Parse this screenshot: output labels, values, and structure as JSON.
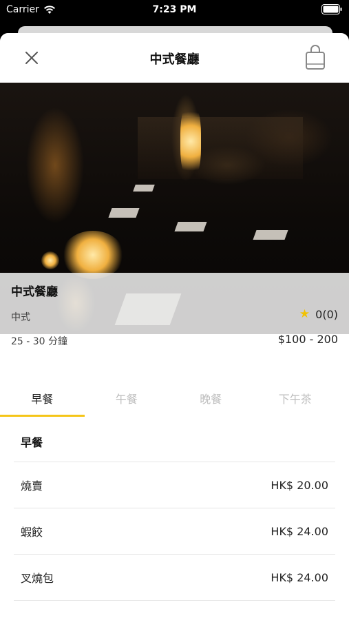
{
  "status_bar": {
    "carrier": "Carrier",
    "time": "7:23 PM"
  },
  "nav": {
    "title": "中式餐廳",
    "close_icon": "close-icon",
    "cart_icon": "shopping-bag-icon"
  },
  "restaurant": {
    "name": "中式餐廳",
    "cuisine": "中式",
    "rating": "0(0)",
    "delivery_time": "25 - 30 分鐘",
    "price_range": "$100 - 200"
  },
  "tabs": [
    {
      "label": "早餐",
      "active": true
    },
    {
      "label": "午餐",
      "active": false
    },
    {
      "label": "晚餐",
      "active": false
    },
    {
      "label": "下午茶",
      "active": false
    }
  ],
  "menu": {
    "section_title": "早餐",
    "items": [
      {
        "name": "燒賣",
        "price": "HK$ 20.00"
      },
      {
        "name": "蝦餃",
        "price": "HK$ 24.00"
      },
      {
        "name": "叉燒包",
        "price": "HK$ 24.00"
      }
    ]
  },
  "colors": {
    "accent": "#f5c518",
    "star": "#f2c200"
  }
}
